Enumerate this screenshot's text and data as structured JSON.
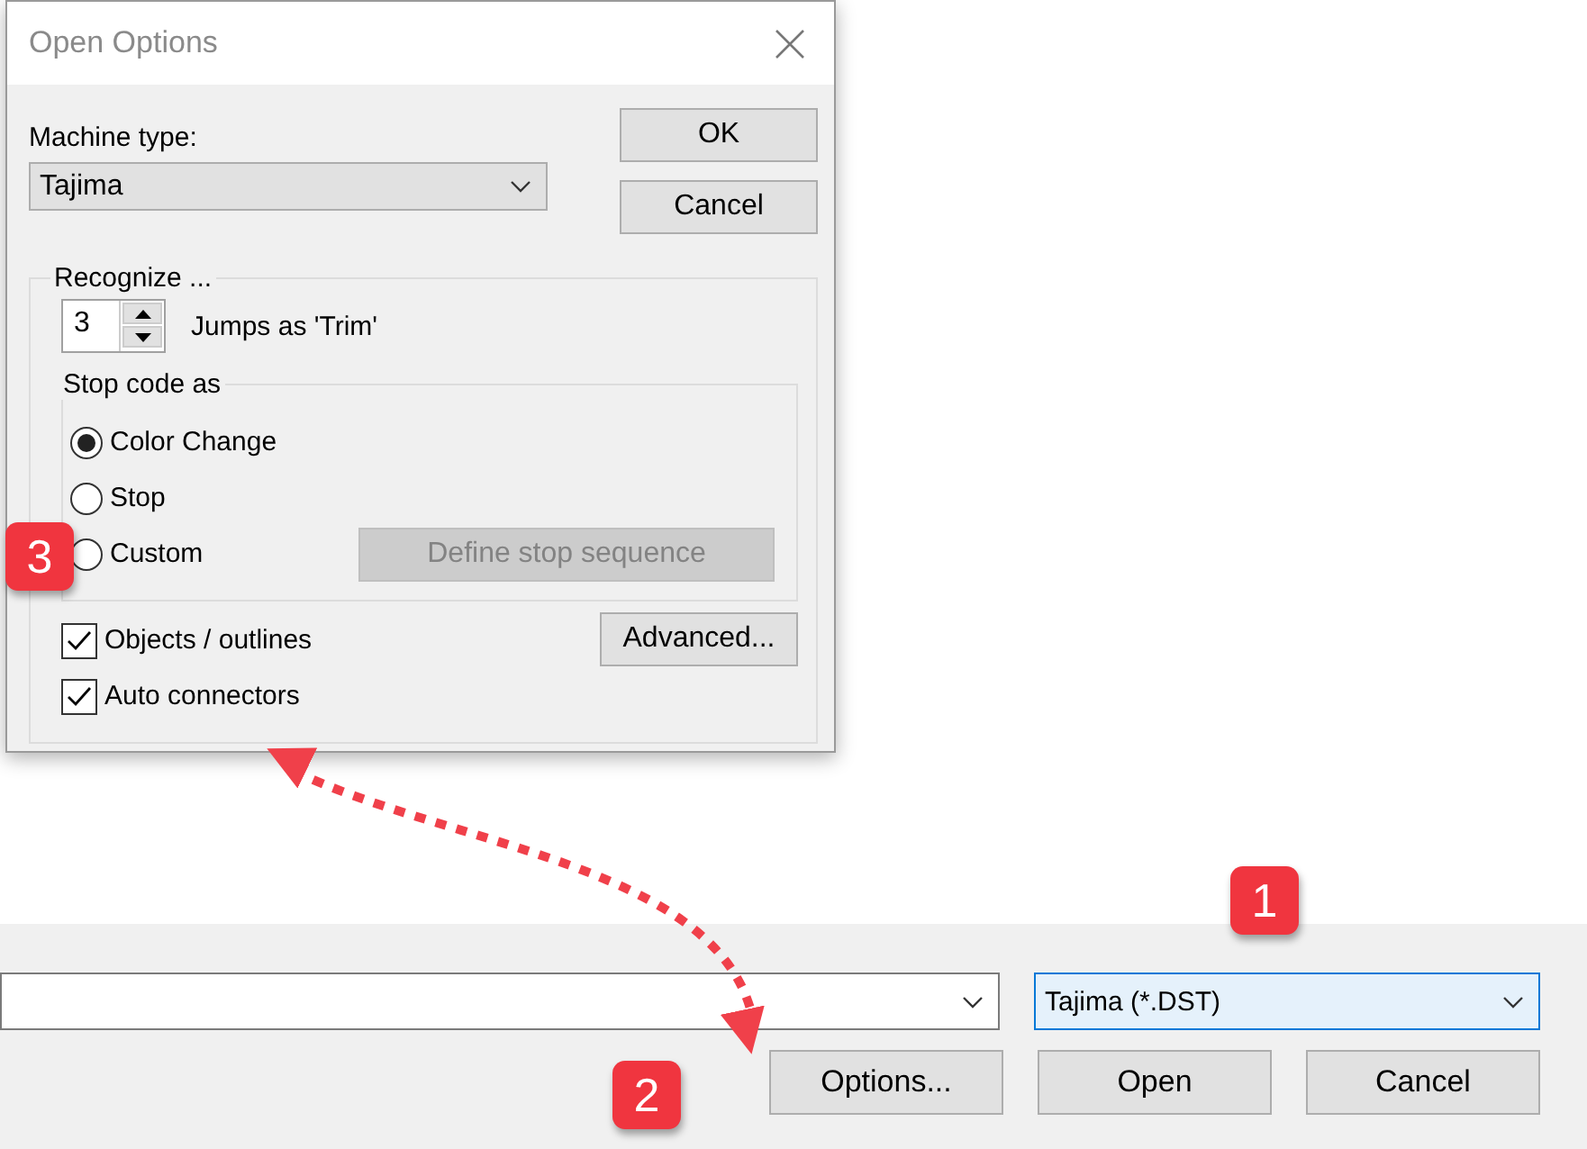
{
  "dialog": {
    "title": "Open Options",
    "machine_type": {
      "label": "Machine type:",
      "value": "Tajima"
    },
    "buttons": [
      {
        "label": "OK"
      },
      {
        "label": "Cancel"
      }
    ],
    "recognize": {
      "title": "Recognize ...",
      "jumps_value": "3",
      "jumps_label": "Jumps as 'Trim'",
      "stop_code": {
        "title": "Stop code as",
        "options": [
          {
            "label": "Color Change",
            "selected": true
          },
          {
            "label": "Stop",
            "selected": false
          },
          {
            "label": "Custom",
            "selected": false
          }
        ],
        "define_button": {
          "label": "Define stop sequence",
          "disabled": true
        }
      },
      "checkboxes": [
        {
          "label": "Objects / outlines",
          "checked": true
        },
        {
          "label": "Auto connectors",
          "checked": true
        }
      ],
      "advanced_button": {
        "label": "Advanced..."
      }
    }
  },
  "file_panel": {
    "file_type": {
      "value": "Tajima (*.DST)",
      "focused": true
    },
    "buttons": [
      {
        "label": "Options..."
      },
      {
        "label": "Open"
      },
      {
        "label": "Cancel"
      }
    ]
  },
  "badges": [
    {
      "label": "1"
    },
    {
      "label": "2"
    },
    {
      "label": "3"
    }
  ]
}
